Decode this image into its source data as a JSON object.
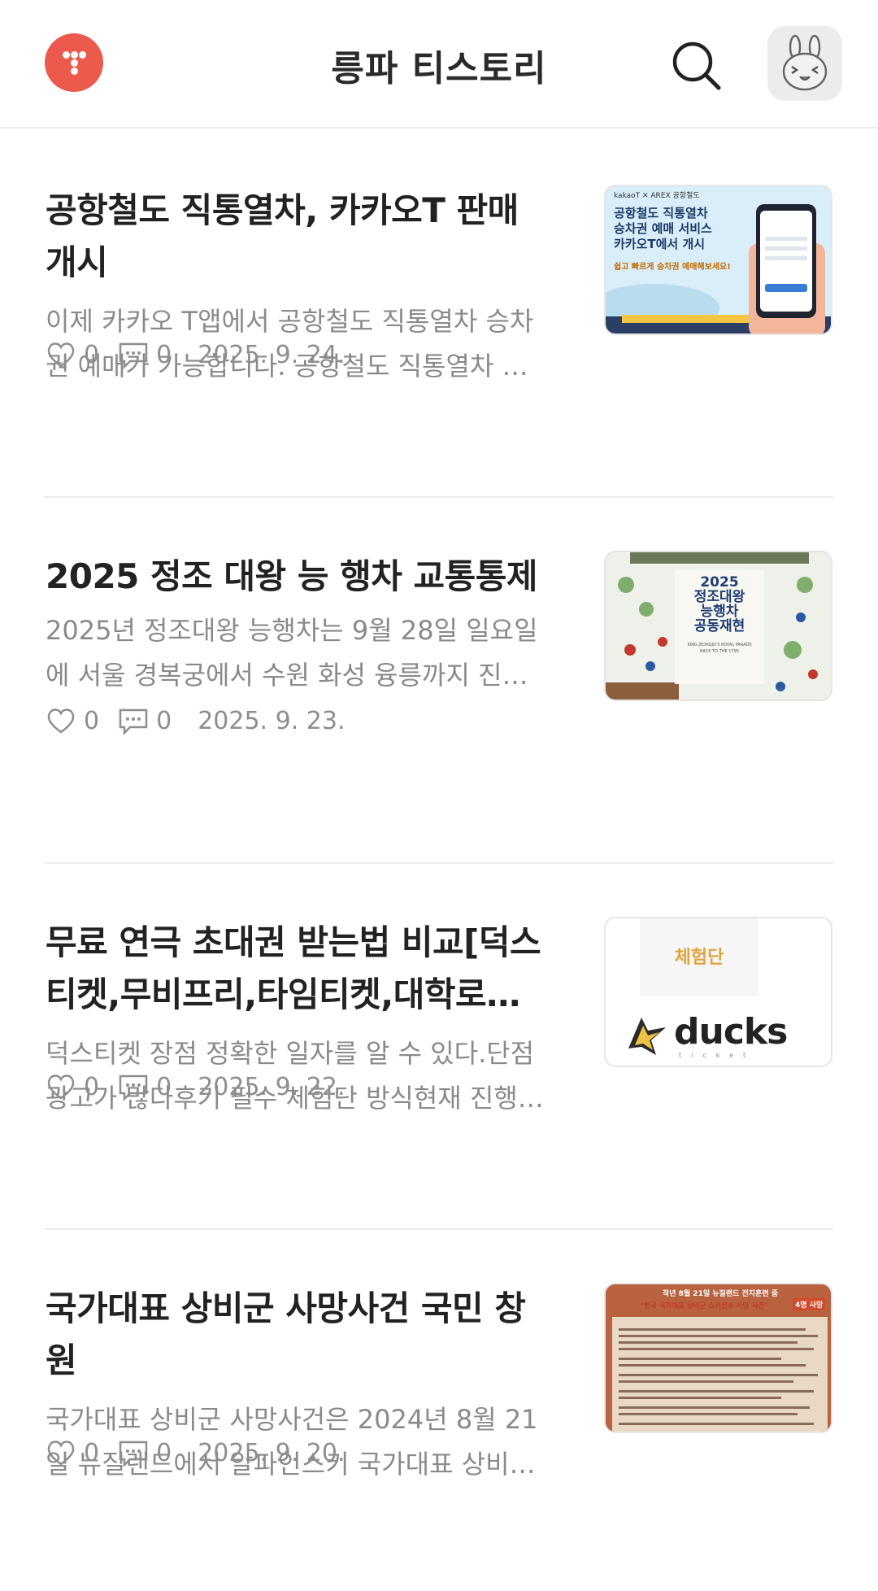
{
  "header": {
    "blog_title": "릉파 티스토리",
    "logo_icon": "tistory-logo-icon",
    "search_icon": "search-icon",
    "avatar_icon": "rabbit-avatar-icon",
    "logo_color": "#eb5a4c"
  },
  "posts": [
    {
      "title": "공항철도 직통열차, 카카오T 판매 개시",
      "excerpt": "이제 카카오 T앱에서 공항철도 직통열차 승차권 예매가 가능합니다. 공항철도 직통열차 승차권 예매 서비스를 카카오T에서 이용할 수 있습니다.",
      "likes": "0",
      "comments": "0",
      "date": "2025. 9. 24.",
      "thumb": {
        "badge": "kakaoT  ✕  AREX 공항철도",
        "line1": "공항철도 직통열차",
        "line2": "승차권 예매 서비스",
        "line3": "카카오T에서 개시",
        "line4": "쉽고 빠르게 승차권 예매해보세요!"
      }
    },
    {
      "title": "2025 정조 대왕 능 행차 교통통제",
      "excerpt": "2025년 정조대왕 능행차는 9월 28일 일요일에 서울 경복궁에서 수원 화성 융릉까지 진행됩니다.",
      "likes": "0",
      "comments": "0",
      "date": "2025. 9. 23.",
      "thumb": {
        "line1": "2025",
        "line2": "정조대왕",
        "line3": "능행차",
        "line4": "공동재현",
        "line5": "KING JEONGJO'S ROYAL PARADE",
        "line6": "BACK TO THE 1795"
      }
    },
    {
      "title": "무료 연극 초대권 받는법 비교[덕스티켓,무비프리,타임티켓,대학로티켓]",
      "excerpt": "덕스티켓 장점 정확한 일자를 알 수 있다.단점광고가 많다후기 필수 체험단 방식현재 진행 중인 공연을 확인할 수 있다.",
      "likes": "0",
      "comments": "0",
      "date": "2025. 9. 22.",
      "thumb": {
        "tag": "체험단",
        "brand": "ducks",
        "sub": "ticket"
      }
    },
    {
      "title": "국가대표 상비군 사망사건 국민 창원",
      "excerpt": "국가대표 상비군 사망사건은 2024년 8월 21일 뉴질랜드에서 알파인스키 국가대표 상비군 선수들이 사고를 당한 사건입니다.",
      "likes": "0",
      "comments": "0",
      "date": "2025. 9. 20.",
      "thumb": {
        "line1": "작년 8월 21일 뉴질랜드 전지훈련 중",
        "line2": "\"한국 국가대표 상비군 스키선수 사망 사건\"",
        "badge": "4명 사망"
      }
    }
  ]
}
